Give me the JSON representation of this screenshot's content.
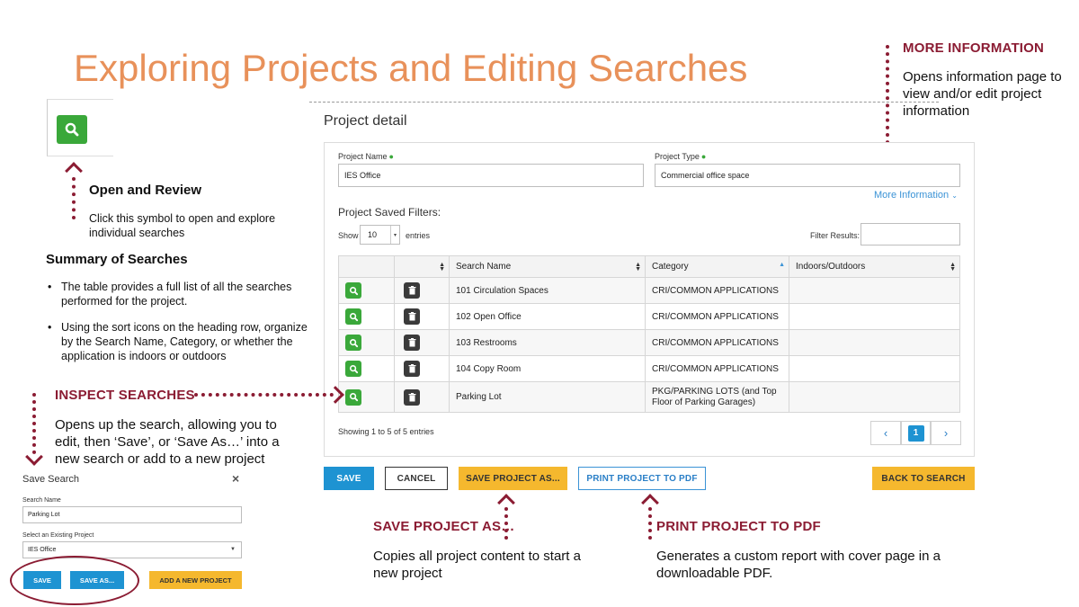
{
  "slide": {
    "title": "Exploring Projects and Editing Searches"
  },
  "callouts": {
    "more_information": {
      "heading": "MORE INFORMATION",
      "body": "Opens information page to view and/or edit project information"
    },
    "open_and_review": {
      "heading": "Open and Review",
      "body": "Click this symbol to open and explore individual searches"
    },
    "summary": {
      "heading": "Summary of Searches",
      "bullets": [
        "The table provides a full list of all the searches performed for the project.",
        "Using the sort icons on the heading row, organize by the Search Name, Category, or whether the application is indoors or outdoors"
      ]
    },
    "inspect_searches": {
      "heading": "INSPECT SEARCHES",
      "body": "Opens up the search, allowing you to edit, then ‘Save’, or ‘Save As…’ into a new search or add to a new project"
    },
    "save_project_as": {
      "heading": "SAVE PROJECT AS…",
      "body": "Copies all project content to start a new project"
    },
    "print_project": {
      "heading": "PRINT PROJECT TO PDF",
      "body": "Generates a custom report with cover page in a downloadable PDF."
    }
  },
  "project_detail": {
    "title": "Project detail",
    "project_name_label": "Project Name",
    "project_name_value": "IES Office",
    "project_type_label": "Project Type",
    "project_type_value": "Commercial office space",
    "more_information_link": "More Information",
    "saved_filters_label": "Project Saved Filters:",
    "show_label": "Show",
    "show_value": "10",
    "entries_label": "entries",
    "filter_results_label": "Filter Results:",
    "columns": [
      "",
      "",
      "Search Name",
      "Category",
      "Indoors/Outdoors"
    ],
    "rows": [
      {
        "search_name": "101 Circulation Spaces",
        "category": "CRI/COMMON APPLICATIONS",
        "indoors_outdoors": ""
      },
      {
        "search_name": "102 Open Office",
        "category": "CRI/COMMON APPLICATIONS",
        "indoors_outdoors": ""
      },
      {
        "search_name": "103 Restrooms",
        "category": "CRI/COMMON APPLICATIONS",
        "indoors_outdoors": ""
      },
      {
        "search_name": "104 Copy Room",
        "category": "CRI/COMMON APPLICATIONS",
        "indoors_outdoors": ""
      },
      {
        "search_name": "Parking Lot",
        "category": "PKG/PARKING LOTS (and Top Floor of Parking Garages)",
        "indoors_outdoors": ""
      }
    ],
    "showing_text": "Showing 1 to 5 of 5 entries",
    "pager": {
      "prev": "‹",
      "current": "1",
      "next": "›"
    },
    "buttons": {
      "save": "SAVE",
      "cancel": "CANCEL",
      "save_project_as": "SAVE PROJECT AS...",
      "print_project": "PRINT PROJECT TO PDF",
      "back_to_search": "BACK TO SEARCH"
    }
  },
  "save_search_dialog": {
    "title": "Save Search",
    "close": "×",
    "search_name_label": "Search Name",
    "search_name_value": "Parking Lot",
    "existing_project_label": "Select an Existing Project",
    "existing_project_value": "IES Office",
    "buttons": {
      "save": "SAVE",
      "save_as": "SAVE AS...",
      "add_new_project": "ADD A NEW PROJECT"
    }
  },
  "colors": {
    "title_orange": "#e8915a",
    "crimson": "#8b1c33",
    "green": "#3aa83a",
    "blue": "#1e93d2",
    "yellow": "#f5b82e",
    "dark": "#3b3b3b"
  },
  "icons": {
    "search_button": "search-icon",
    "delete_button": "trash-icon",
    "sort": "sort-icon",
    "close": "close-icon"
  }
}
